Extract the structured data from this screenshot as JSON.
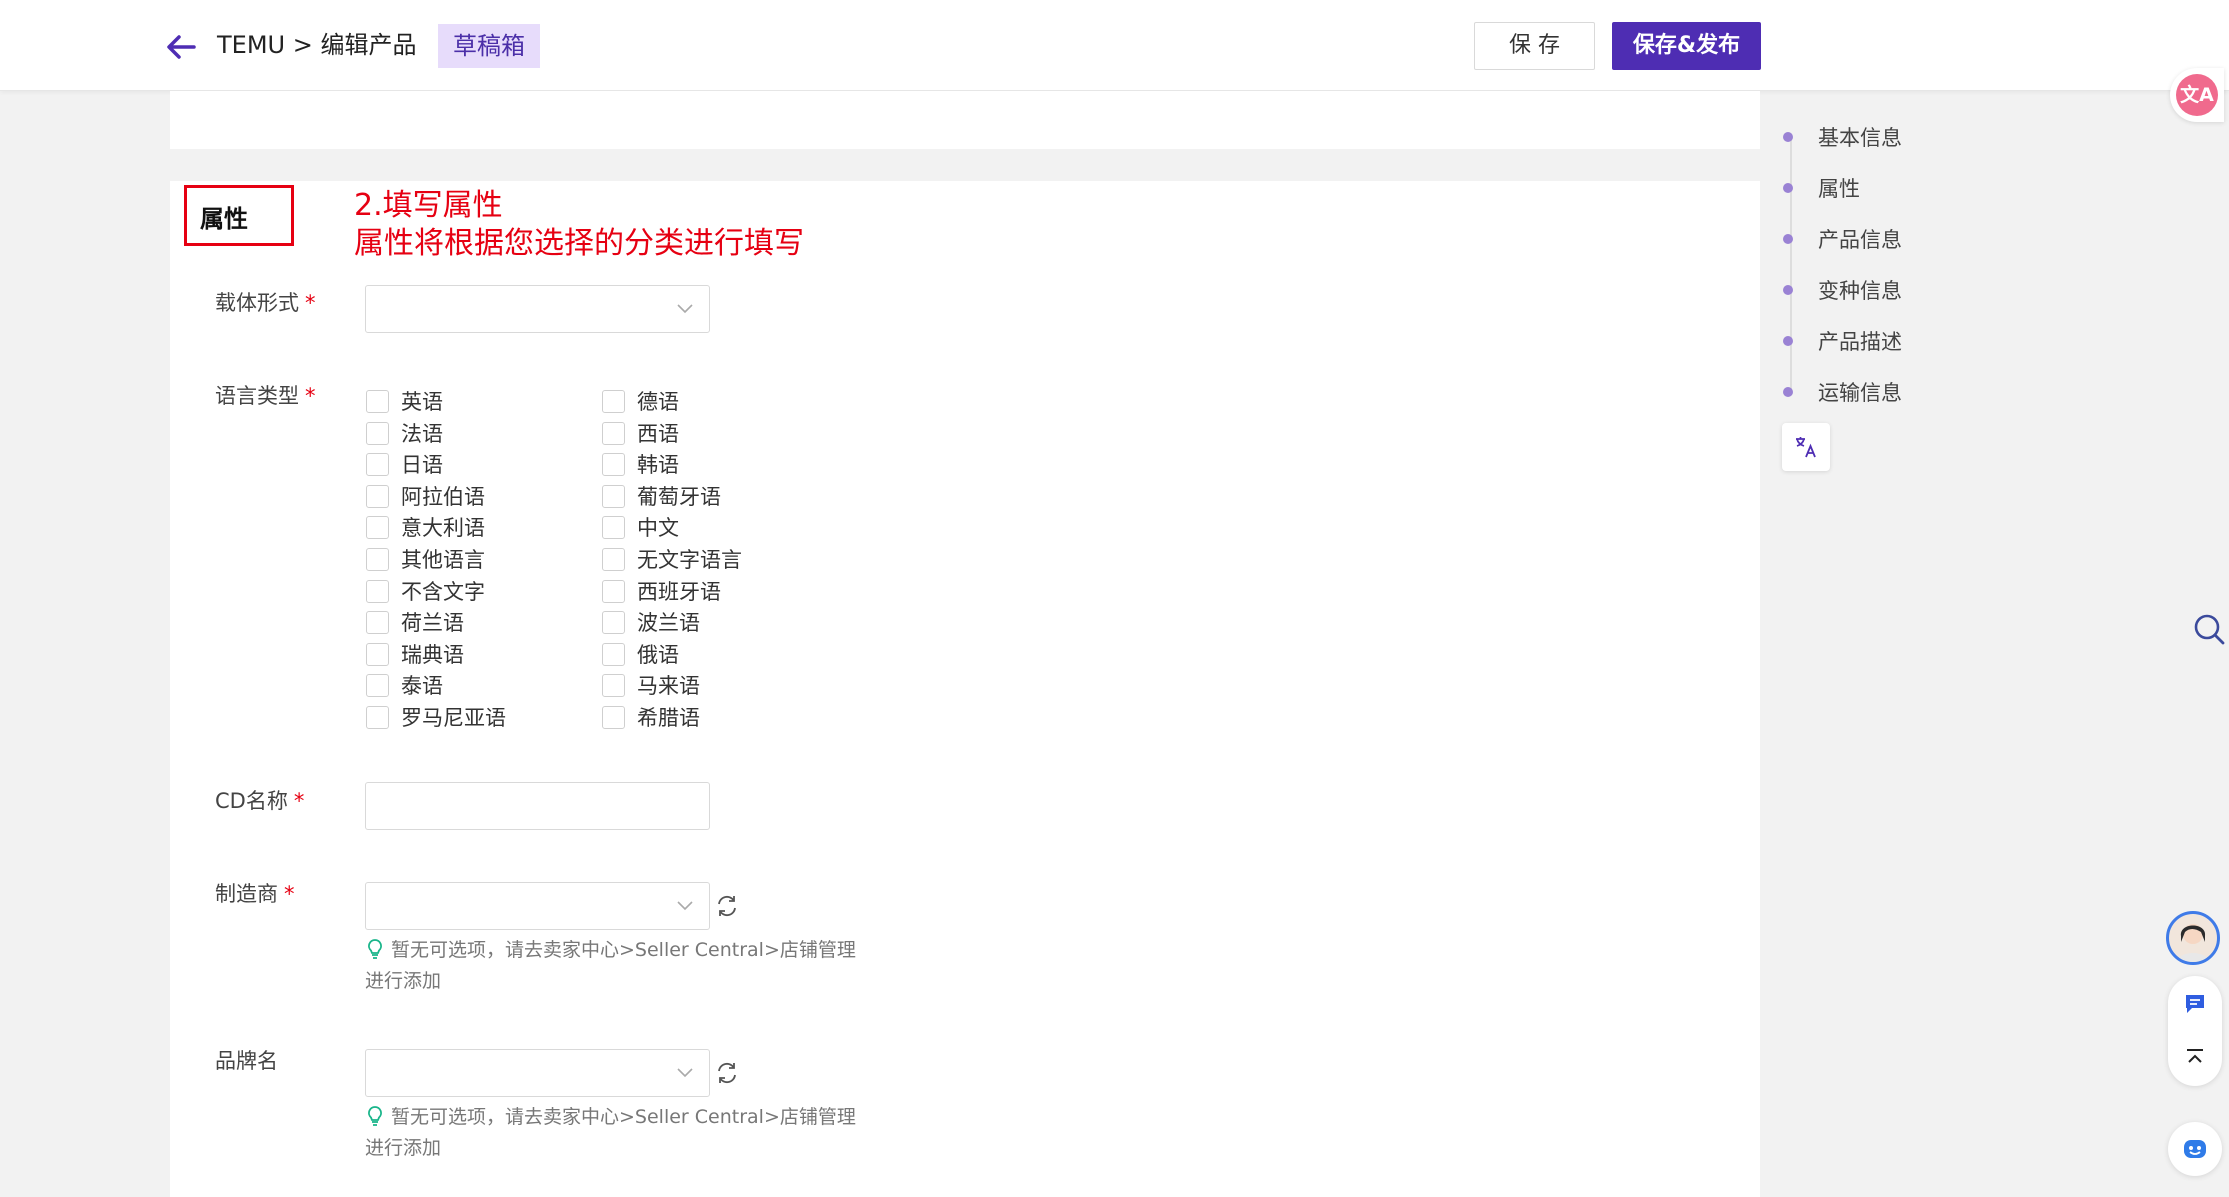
{
  "header": {
    "breadcrumb": "TEMU > 编辑产品",
    "status_tag": "草稿箱",
    "save_label": "保 存",
    "publish_label": "保存&发布"
  },
  "section": {
    "title": "属性",
    "annotation_line1": "2.填写属性",
    "annotation_line2": "属性将根据您选择的分类进行填写"
  },
  "form": {
    "carrier_label": "载体形式",
    "language_label": "语言类型",
    "cd_name_label": "CD名称",
    "manufacturer_label": "制造商",
    "brand_label": "品牌名",
    "required_mark": "*",
    "languages_col1": [
      "英语",
      "法语",
      "日语",
      "阿拉伯语",
      "意大利语",
      "其他语言",
      "不含文字",
      "荷兰语",
      "瑞典语",
      "泰语",
      "罗马尼亚语"
    ],
    "languages_col2": [
      "德语",
      "西语",
      "韩语",
      "葡萄牙语",
      "中文",
      "无文字语言",
      "西班牙语",
      "波兰语",
      "俄语",
      "马来语",
      "希腊语"
    ],
    "hint_line1": "暂无可选项，请去卖家中心>Seller Central>店铺管理",
    "hint_line2": "进行添加"
  },
  "side_nav": {
    "items": [
      "基本信息",
      "属性",
      "产品信息",
      "变种信息",
      "产品描述",
      "运输信息"
    ]
  },
  "floating": {
    "translate_glyph": "文A"
  },
  "colors": {
    "primary": "#4e2db3",
    "annotation": "#e60012",
    "tag_bg": "#e7dcfb"
  }
}
